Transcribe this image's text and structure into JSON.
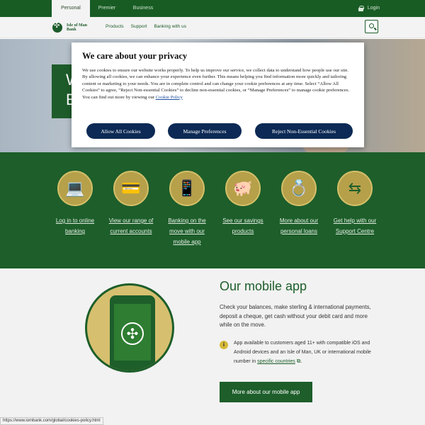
{
  "topbar": {
    "tabs": [
      {
        "label": "Personal",
        "active": true
      },
      {
        "label": "Premier",
        "active": false
      },
      {
        "label": "Business",
        "active": false
      }
    ],
    "login_label": "Login"
  },
  "nav": {
    "logo_line1": "Isle of Man",
    "logo_line2": "Bank",
    "links": [
      "Products",
      "Support",
      "Banking with us"
    ]
  },
  "hero": {
    "line1": "W",
    "line2": "E"
  },
  "privacy": {
    "title": "We care about your privacy",
    "body": "We use cookies to ensure our website works properly. To help us improve our service, we collect data to understand how people use our site. By allowing all cookies, we can enhance your experience even further. This means helping you find information more quickly and tailoring content or marketing to your needs. You are in complete control and can change your cookie preferences at any time. Select “Allow All Cookies” to agree, “Reject Non-essential Cookies” to decline non-essential cookies, or “Manage Preferences” to manage cookie preferences. You can find out more by viewing our",
    "policy_link": "Cookie Policy",
    "buttons": {
      "allow": "Allow All Cookies",
      "manage": "Manage Preferences",
      "reject": "Reject Non-Essential Cookies"
    }
  },
  "quick_links": [
    {
      "icon": "laptop-icon",
      "glyph": "💻",
      "label": "Log in to online banking"
    },
    {
      "icon": "cards-icon",
      "glyph": "💳",
      "label": "View our range of current accounts"
    },
    {
      "icon": "mobile-phone-icon",
      "glyph": "📱",
      "label": "Banking on the move with our mobile app"
    },
    {
      "icon": "piggy-bank-icon",
      "glyph": "🐖",
      "label": "See our savings products"
    },
    {
      "icon": "ring-icon",
      "glyph": "💍",
      "label": "More about our personal loans"
    },
    {
      "icon": "signpost-icon",
      "glyph": "⇆",
      "label": "Get help with our Support Centre"
    }
  ],
  "mobile_app": {
    "title": "Our mobile app",
    "description": "Check your balances, make sterling & international payments, deposit a cheque, get cash without your debit card and more while on the move.",
    "note_prefix": "App available to customers aged 11+ with compatible iOS and Android devices and an Isle of Man, UK or international mobile number in",
    "note_link": "specific countries",
    "note_suffix": ".",
    "cta_label": "More about our mobile app"
  },
  "status_url": "https://www.iombank.com/global/cookies-policy.html",
  "colors": {
    "brand_green": "#1d5e2a",
    "dialog_button": "#0c2a55",
    "gold": "#b6a04a"
  }
}
